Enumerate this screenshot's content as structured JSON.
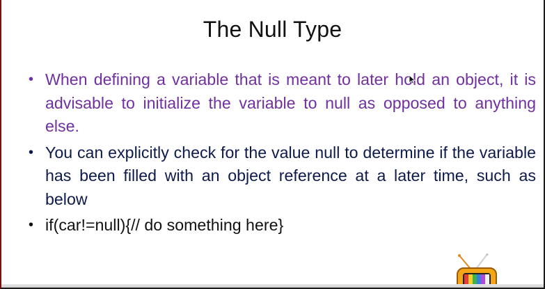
{
  "slide": {
    "title": "The Null Type",
    "bullets": [
      {
        "text": "When defining a variable that is meant to later hold an object, it is advisable to initialize the variable to null as opposed to anything else.",
        "color": "#7030a0"
      },
      {
        "text": "You can explicitly check for the value null to determine if the variable has been filled with an object reference at a later time, such as below",
        "color": "#0d1b4b"
      },
      {
        "text": "if(car!=null){// do something here}",
        "color": "#111111"
      }
    ],
    "bullet_symbol": "•"
  },
  "overlay": {
    "cursor_icon": "mouse-pointer-icon",
    "logo_icon": "retro-tv-logo-icon"
  }
}
